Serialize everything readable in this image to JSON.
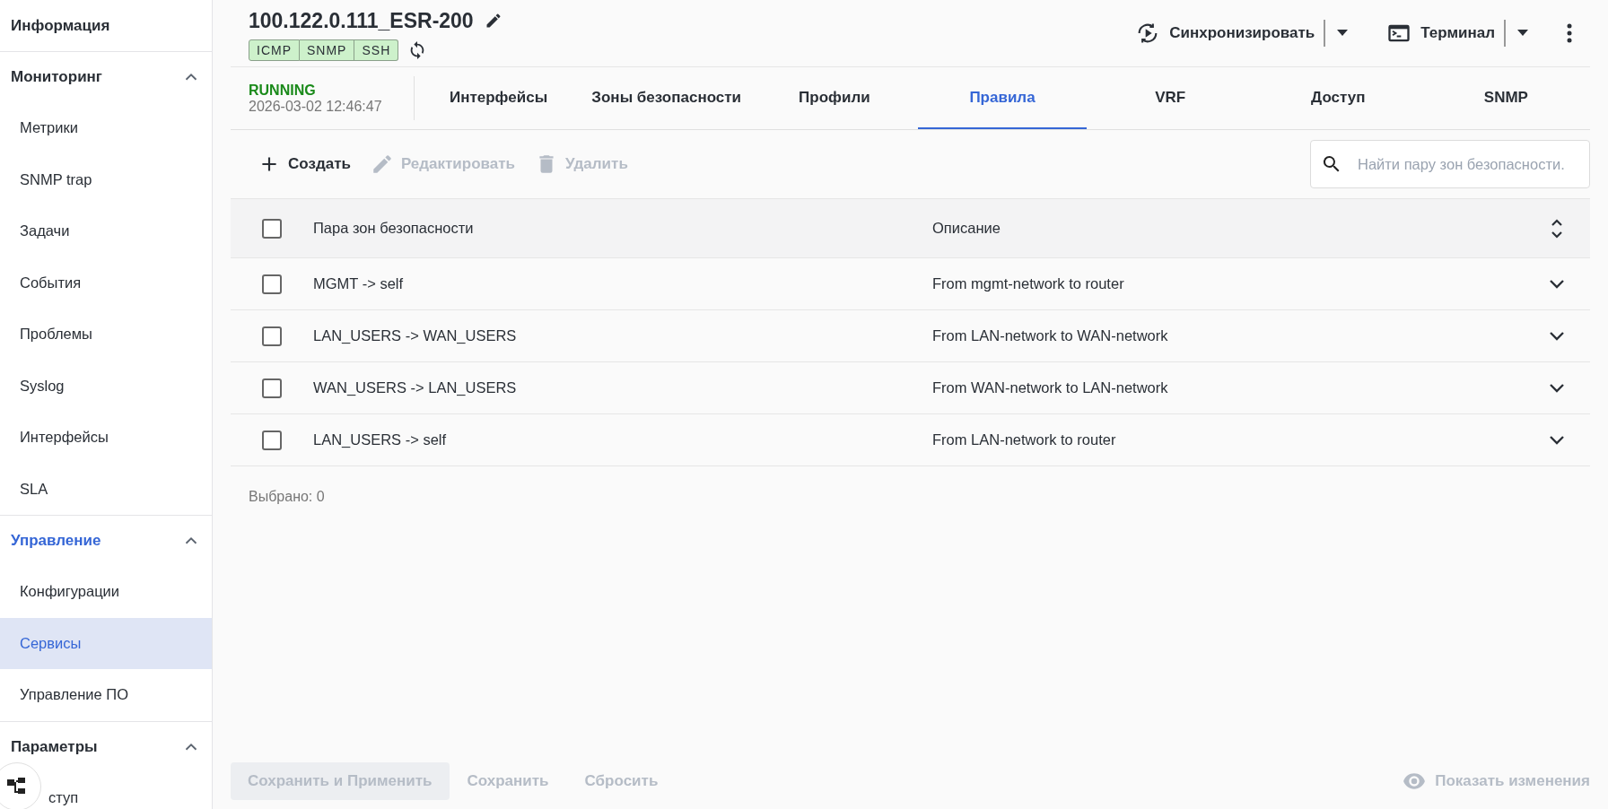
{
  "sidebar": {
    "sections": [
      {
        "title": "Информация",
        "highlighted": false
      },
      {
        "title": "Мониторинг",
        "expanded": true,
        "highlighted": false,
        "items": [
          {
            "label": "Метрики",
            "selected": false
          },
          {
            "label": "SNMP trap",
            "selected": false
          },
          {
            "label": "Задачи",
            "selected": false
          },
          {
            "label": "События",
            "selected": false
          },
          {
            "label": "Проблемы",
            "selected": false
          },
          {
            "label": "Syslog",
            "selected": false
          },
          {
            "label": "Интерфейсы",
            "selected": false
          },
          {
            "label": "SLA",
            "selected": false
          }
        ]
      },
      {
        "title": "Управление",
        "expanded": true,
        "highlighted": true,
        "items": [
          {
            "label": "Конфигурации",
            "selected": false
          },
          {
            "label": "Сервисы",
            "selected": true
          },
          {
            "label": "Управление ПО",
            "selected": false
          }
        ]
      },
      {
        "title": "Параметры",
        "expanded": true,
        "highlighted": false,
        "items": [
          {
            "label": "ступ",
            "selected": false,
            "partly_hidden": true
          }
        ]
      }
    ]
  },
  "header": {
    "title": "100.122.0.111_ESR-200",
    "protocols": [
      "ICMP",
      "SNMP",
      "SSH"
    ],
    "actions": [
      {
        "kind": "sync",
        "label": "Синхронизировать"
      },
      {
        "kind": "terminal",
        "label": "Терминал"
      }
    ]
  },
  "status": {
    "state": "RUNNING",
    "time": "2026-03-02 12:46:47"
  },
  "tabs": [
    {
      "label": "Интерфейсы",
      "selected": false
    },
    {
      "label": "Зоны безопасности",
      "selected": false
    },
    {
      "label": "Профили",
      "selected": false
    },
    {
      "label": "Правила",
      "selected": true
    },
    {
      "label": "VRF",
      "selected": false
    },
    {
      "label": "Доступ",
      "selected": false
    },
    {
      "label": "SNMP",
      "selected": false
    }
  ],
  "toolbar": [
    {
      "kind": "create",
      "label": "Создать",
      "disabled": false
    },
    {
      "kind": "edit",
      "label": "Редактировать",
      "disabled": true
    },
    {
      "kind": "delete",
      "label": "Удалить",
      "disabled": true
    }
  ],
  "search": {
    "placeholder": "Найти пару зон безопасности."
  },
  "table": {
    "all_checked": false,
    "columns": [
      "Пара зон безопасности",
      "Описание"
    ],
    "rows": [
      {
        "checked": false,
        "zone_pair": "MGMT -> self",
        "description": "From mgmt-network to router"
      },
      {
        "checked": false,
        "zone_pair": "LAN_USERS -> WAN_USERS",
        "description": "From LAN-network to WAN-network"
      },
      {
        "checked": false,
        "zone_pair": "WAN_USERS -> LAN_USERS",
        "description": "From WAN-network to LAN-network"
      },
      {
        "checked": false,
        "zone_pair": "LAN_USERS -> self",
        "description": "From LAN-network to router"
      }
    ]
  },
  "selected_count": "Выбрано: 0",
  "footer": {
    "buttons": [
      {
        "kind": "primary",
        "label": "Сохранить и Применить",
        "disabled": true
      },
      {
        "kind": "text",
        "label": "Сохранить",
        "disabled": true
      },
      {
        "kind": "text",
        "label": "Сбросить",
        "disabled": true
      }
    ],
    "show_changes": {
      "label": "Показать изменения",
      "disabled": true
    }
  }
}
